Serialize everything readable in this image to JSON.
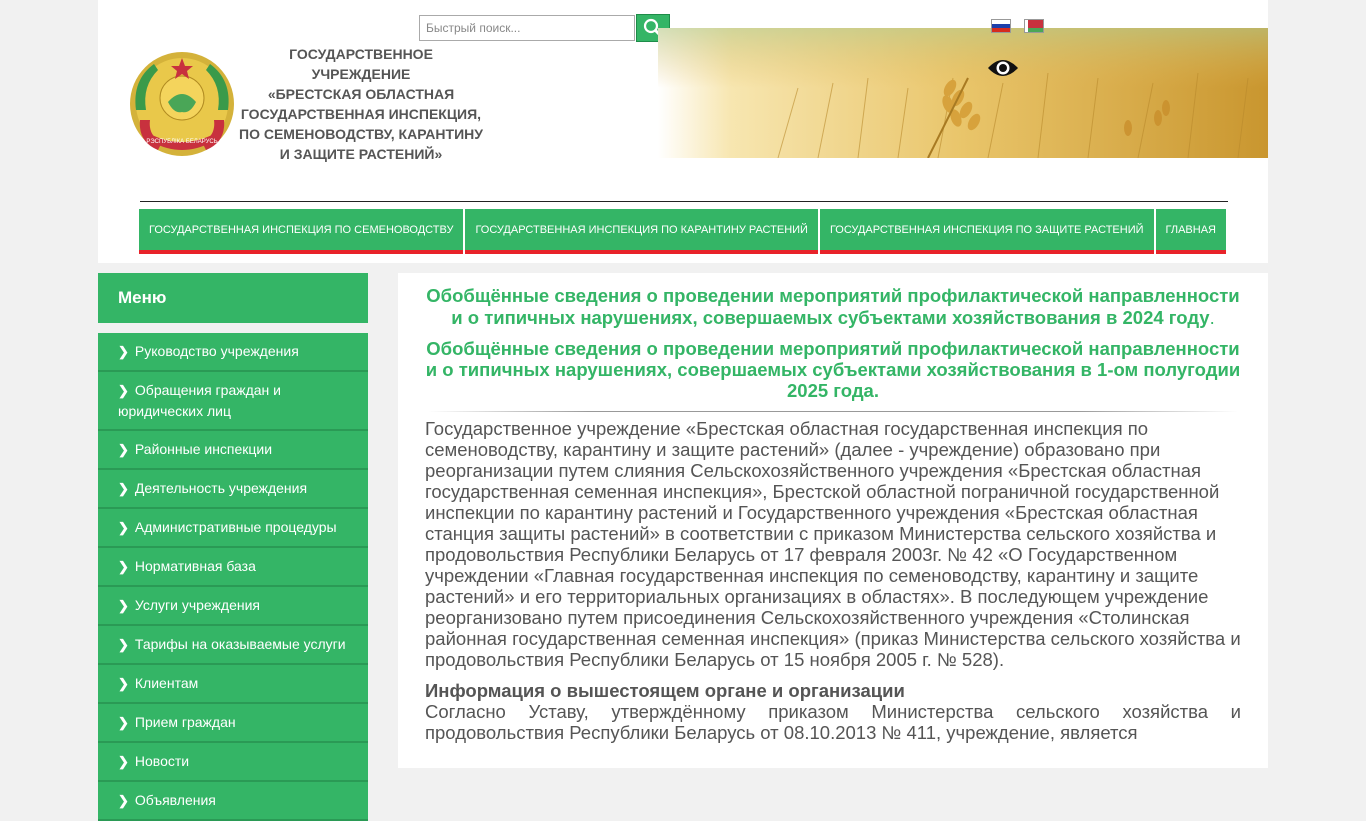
{
  "search": {
    "placeholder": "Быстрый поиск..."
  },
  "header": {
    "title_lines": [
      "ГОСУДАРСТВЕННОЕ",
      "УЧРЕЖДЕНИЕ",
      "«БРЕСТСКАЯ ОБЛАСТНАЯ",
      "ГОСУДАРСТВЕННАЯ ИНСПЕКЦИЯ,",
      "ПО СЕМЕНОВОДСТВУ, КАРАНТИНУ",
      "И ЗАЩИТЕ РАСТЕНИЙ»"
    ],
    "emblem_text": "РЭСПУБЛІКА БЕЛАРУСЬ"
  },
  "icons": {
    "search": "search-icon",
    "eye": "eye-icon",
    "chevron": "chevron-right-icon"
  },
  "colors": {
    "accent": "#34b566",
    "nav_underline": "#e8232a",
    "text": "#555555"
  },
  "nav": {
    "items": [
      "ГОСУДАРСТВЕННАЯ ИНСПЕКЦИЯ ПО СЕМЕНОВОДСТВУ",
      "ГОСУДАРСТВЕННАЯ ИНСПЕКЦИЯ ПО КАРАНТИНУ РАСТЕНИЙ",
      "ГОСУДАРСТВЕННАЯ ИНСПЕКЦИЯ ПО ЗАЩИТЕ РАСТЕНИЙ",
      "ГЛАВНАЯ"
    ]
  },
  "sidebar": {
    "title": "Меню",
    "items": [
      "Руководство учреждения",
      "Обращения граждан и юридических лиц",
      "Районные инспекции",
      "Деятельность учреждения",
      "Административные процедуры",
      "Нормативная база",
      "Услуги учреждения",
      "Тарифы на оказываемые услуги",
      "Клиентам",
      "Прием граждан",
      "Новости",
      "Объявления"
    ]
  },
  "content": {
    "link1": "Обобщённые сведения о проведении мероприятий профилактической направленности и о типичных нарушениях, совершаемых субъектами хозяйствования в 2024 году",
    "link1_tail": ".",
    "link2": "Обобщённые сведения о проведении мероприятий профилактической направленности и о типичных нарушениях, совершаемых субъектами хозяйствования в 1-ом полугодии 2025 года.",
    "intro": " Государственное учреждение «Брестская областная государственная инспекция по семеноводству, карантину и защите растений» (далее - учреждение) образовано при реорганизации путем слияния Сельскохозяйственного учреждения «Брестская областная государственная семенная инспекция», Брестской областной пограничной государственной инспекции по карантину растений и Государственного учреждения «Брестская областная станция защиты растений» в соответствии с приказом Министерства сельского хозяйства и продовольствия Республики Беларусь от 17 февраля 2003г. № 42 «О Государственном учреждении «Главная государственная инспекция по семеноводству, карантину и защите растений» и его территориальных организациях в областях». В последующем учреждение реорганизовано путем присоединения Сельскохозяйственного учреждения «Столинская районная государственная семенная инспекция» (приказ Министерства сельского хозяйства и продовольствия Республики Беларусь от 15 ноября 2005 г. № 528).",
    "subheading": "Информация о вышестоящем органе и организации",
    "para2": "Согласно Уставу, утверждённому приказом Министерства сельского хозяйства и продовольствия Республики Беларусь от 08.10.2013 № 411,  учреждение, является"
  }
}
